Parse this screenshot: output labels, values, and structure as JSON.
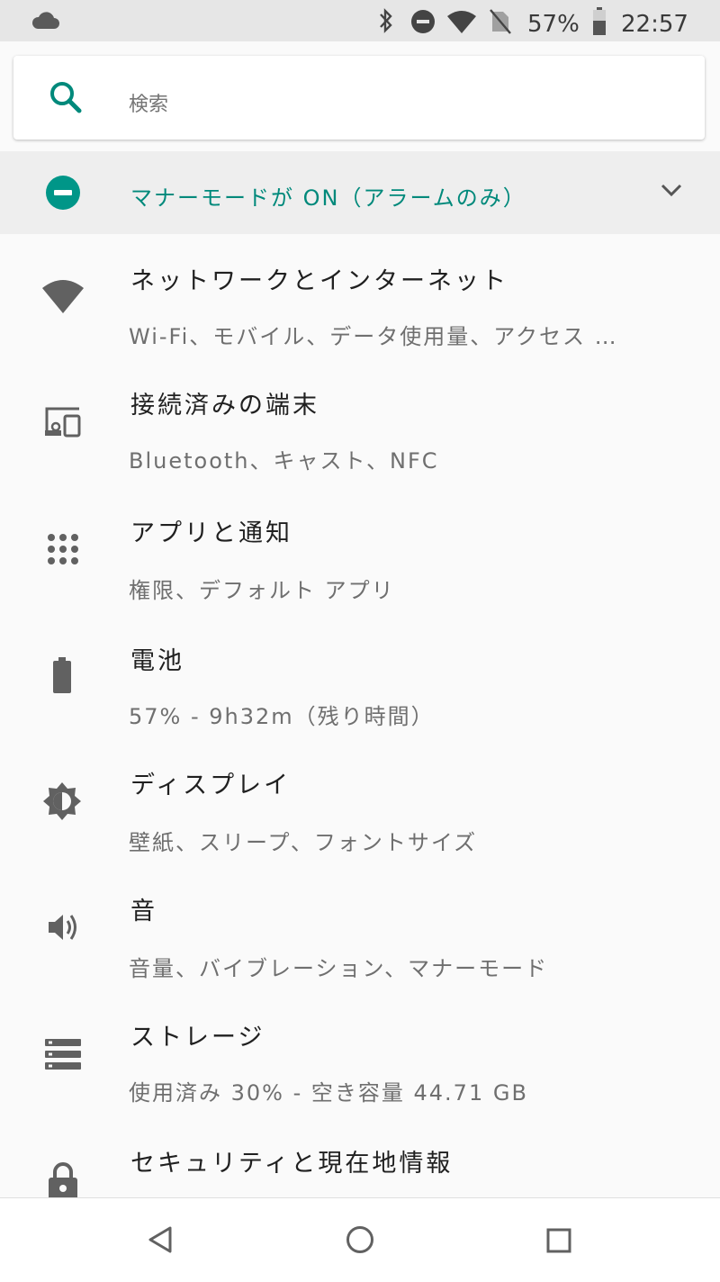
{
  "status_bar": {
    "battery_percent": "57%",
    "time": "22:57",
    "icons": [
      "cloud-icon",
      "bluetooth-icon",
      "do-not-disturb-icon",
      "wifi-icon",
      "no-sim-icon",
      "battery-icon"
    ]
  },
  "search": {
    "placeholder": "検索",
    "icon": "search-icon"
  },
  "banner": {
    "text": "マナーモードが ON（アラームのみ）",
    "icon": "do-not-disturb-icon",
    "chevron": "chevron-down-icon"
  },
  "settings": {
    "items": [
      {
        "title": "ネットワークとインターネット",
        "subtitle": "Wi-Fi、モバイル、データ使用量、アクセス …",
        "icon": "wifi-icon"
      },
      {
        "title": "接続済みの端末",
        "subtitle": "Bluetooth、キャスト、NFC",
        "icon": "devices-icon"
      },
      {
        "title": "アプリと通知",
        "subtitle": "権限、デフォルト アプリ",
        "icon": "apps-grid-icon"
      },
      {
        "title": "電池",
        "subtitle": "57% - 9h32m（残り時間）",
        "icon": "battery-icon"
      },
      {
        "title": "ディスプレイ",
        "subtitle": "壁紙、スリープ、フォントサイズ",
        "icon": "brightness-icon"
      },
      {
        "title": "音",
        "subtitle": "音量、バイブレーション、マナーモード",
        "icon": "volume-icon"
      },
      {
        "title": "ストレージ",
        "subtitle": "使用済み 30% - 空き容量 44.71 GB",
        "icon": "storage-icon"
      },
      {
        "title": "セキュリティと現在地情報",
        "subtitle": "",
        "icon": "lock-icon"
      }
    ]
  },
  "nav_bar": {
    "buttons": [
      "back-icon",
      "home-icon",
      "recents-icon"
    ]
  },
  "colors": {
    "accent": "#009688",
    "icon_gray": "#616161",
    "status_bar_bg": "#e6e6e6"
  }
}
